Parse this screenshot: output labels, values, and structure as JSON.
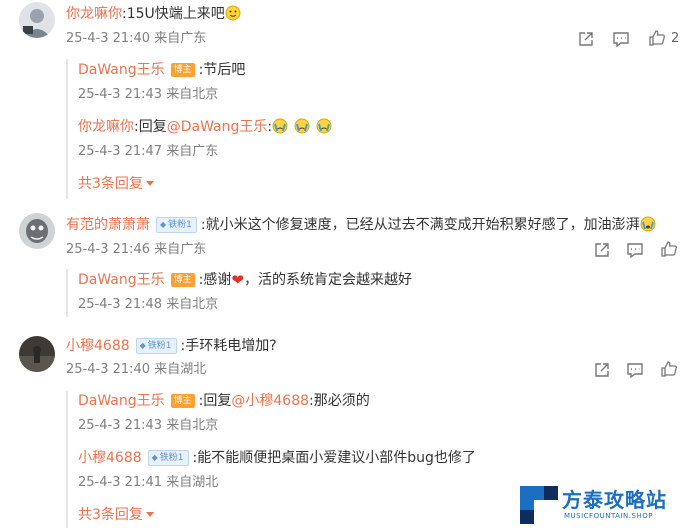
{
  "comments": [
    {
      "user": "你龙嘛你",
      "text": ":15U快端上来吧",
      "time": "25-4-3 21:40",
      "location": "来自广东",
      "likes": "2",
      "replies": [
        {
          "user": "DaWang王乐",
          "badge": "博主",
          "text": ":节后吧",
          "time": "25-4-3 21:43",
          "location": "来自北京"
        },
        {
          "user": "你龙嘛你",
          "reply_prefix": ":回复",
          "mention": "@DaWang王乐",
          "text": ":",
          "time": "25-4-3 21:47",
          "location": "来自广东"
        }
      ],
      "more": "共3条回复"
    },
    {
      "user": "有范的萧萧萧",
      "badge": "铁粉1",
      "text": ":就小米这个修复速度，已经从过去不满变成开始积累好感了，加油澎湃",
      "time": "25-4-3 21:46",
      "location": "来自广东",
      "replies": [
        {
          "user": "DaWang王乐",
          "badge": "博主",
          "text": ":感谢",
          "text_after": "，活的系统肯定会越来越好",
          "time": "25-4-3 21:48",
          "location": "来自北京"
        }
      ]
    },
    {
      "user": "小穆4688",
      "badge": "铁粉1",
      "text": ":手环耗电增加?",
      "time": "25-4-3 21:40",
      "location": "来自湖北",
      "replies": [
        {
          "user": "DaWang王乐",
          "badge": "博主",
          "reply_prefix": ":回复",
          "mention": "@小穆4688",
          "text": ":那必须的",
          "time": "25-4-3 21:43",
          "location": "来自北京"
        },
        {
          "user": "小穆4688",
          "badge": "铁粉1",
          "text": ":能不能顺便把桌面小爱建议小部件bug也修了",
          "time": "25-4-3 21:41",
          "location": "来自湖北"
        }
      ],
      "more": "共3条回复"
    }
  ],
  "icons": [
    "share-icon",
    "comment-icon",
    "like-icon"
  ],
  "watermark": {
    "title": "方泰攻略站",
    "subtitle": "MUSICFOUNTAIN.SHOP"
  },
  "colors": {
    "username": "#eb7350",
    "meta": "#808080",
    "host_badge": "#ffa033",
    "fan_badge": "#5f94cf",
    "watermark": "#1a6fc0"
  }
}
